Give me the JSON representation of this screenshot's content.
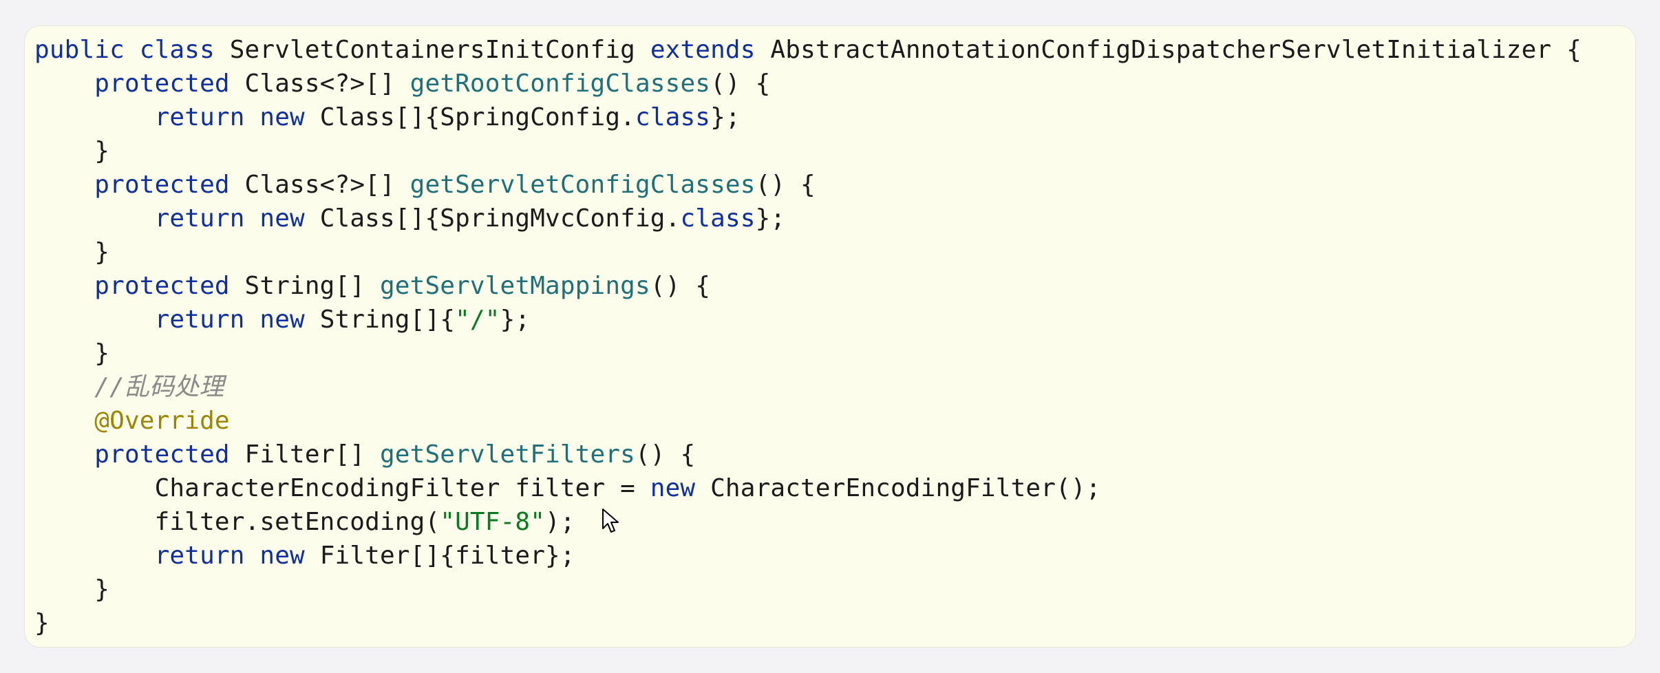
{
  "code": {
    "line1": {
      "kw1": "public",
      "kw2": "class",
      "name": "ServletContainersInitConfig",
      "kw3": "extends",
      "parent": "AbstractAnnotationConfigDispatcherServletInitializer",
      "brace": "{"
    },
    "line2": {
      "kw": "protected",
      "type": "Class<?>[]",
      "method": "getRootConfigClasses",
      "rest": "() {"
    },
    "line3": {
      "kw1": "return",
      "kw2": "new",
      "pre": "Class[]{SpringConfig.",
      "kw3": "class",
      "post": "};"
    },
    "line4": {
      "text": "}"
    },
    "line5": {
      "kw": "protected",
      "type": "Class<?>[]",
      "method": "getServletConfigClasses",
      "rest": "() {"
    },
    "line6": {
      "kw1": "return",
      "kw2": "new",
      "pre": "Class[]{SpringMvcConfig.",
      "kw3": "class",
      "post": "};"
    },
    "line7": {
      "text": "}"
    },
    "line8": {
      "kw": "protected",
      "type": "String[]",
      "method": "getServletMappings",
      "rest": "() {"
    },
    "line9": {
      "kw1": "return",
      "kw2": "new",
      "pre": "String[]{",
      "str": "\"/\"",
      "post": "};"
    },
    "line10": {
      "text": "}"
    },
    "line11": {
      "comment": "//乱码处理"
    },
    "line12": {
      "annotation": "@Override"
    },
    "line13": {
      "kw": "protected",
      "type": "Filter[]",
      "method": "getServletFilters",
      "rest": "() {"
    },
    "line14": {
      "pre": "CharacterEncodingFilter filter = ",
      "kw": "new",
      "post": "CharacterEncodingFilter();"
    },
    "line15": {
      "pre": "filter.setEncoding(",
      "str": "\"UTF-8\"",
      "post": ");"
    },
    "line16": {
      "kw1": "return",
      "kw2": "new",
      "post": "Filter[]{filter};"
    },
    "line17": {
      "text": "}"
    },
    "line18": {
      "text": "}"
    }
  },
  "colors": {
    "panel_bg": "#fdfdeb",
    "keyword": "#0f2f9e",
    "method": "#1f6f7a",
    "string": "#0a7a22",
    "comment": "#8a8a8a",
    "annotation": "#9a8600"
  },
  "icons": {
    "cursor": "mouse-pointer-icon"
  }
}
